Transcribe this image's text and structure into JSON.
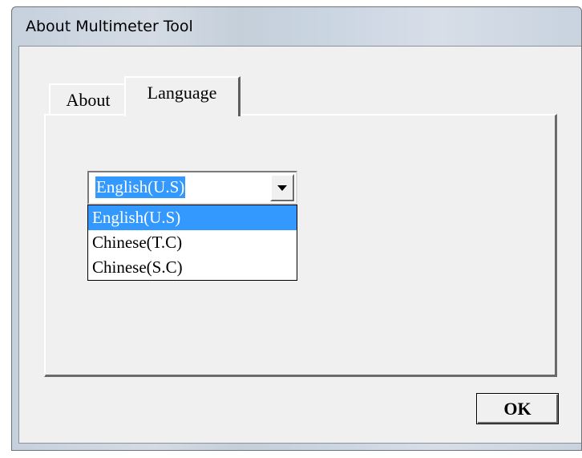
{
  "window": {
    "title": "About Multimeter Tool"
  },
  "tabs": [
    {
      "label": "About",
      "active": false
    },
    {
      "label": "Language",
      "active": true
    }
  ],
  "language": {
    "selected": "English(U.S)",
    "options": [
      "English(U.S)",
      "Chinese(T.C)",
      "Chinese(S.C)"
    ],
    "highlighted_option": "English(U.S)"
  },
  "buttons": {
    "ok_label": "OK"
  },
  "icons": {
    "dropdown_arrow": "chevron-down-icon"
  },
  "colors": {
    "selection": "#3399ff",
    "dialog_face": "#f0f0f0"
  }
}
